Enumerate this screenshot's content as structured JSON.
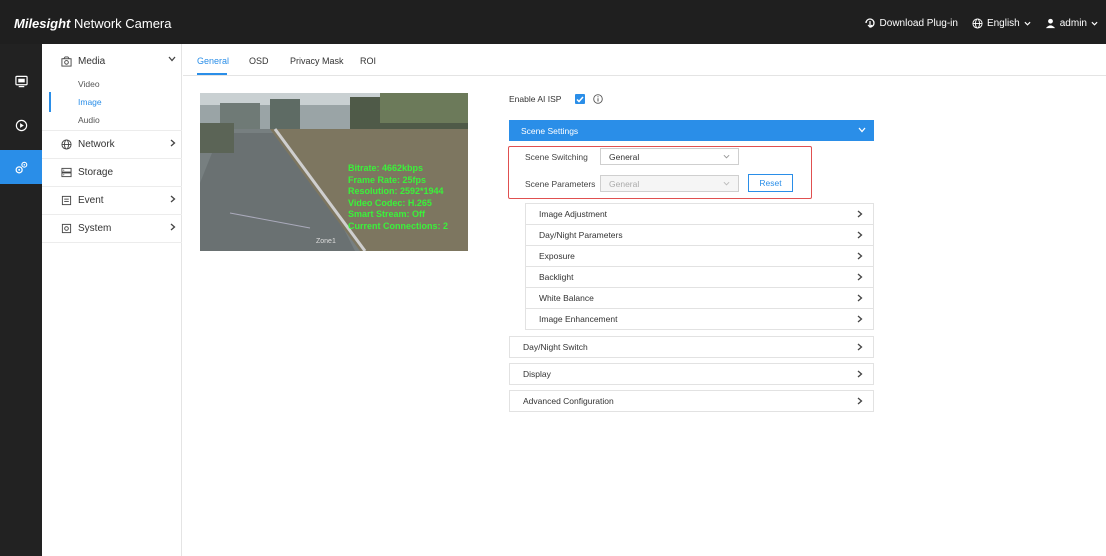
{
  "app": {
    "brand": "Milesight",
    "title": "Network Camera",
    "download_plugin": "Download Plug-in",
    "language": "English",
    "user": "admin"
  },
  "rail_icons": [
    "monitor-icon",
    "playback-icon",
    "settings-icon"
  ],
  "sidebar": {
    "media_label": "Media",
    "media_items": [
      "Video",
      "Image",
      "Audio"
    ],
    "network_label": "Network",
    "storage_label": "Storage",
    "event_label": "Event",
    "system_label": "System"
  },
  "tabs": [
    "General",
    "OSD",
    "Privacy Mask",
    "ROI"
  ],
  "preview": {
    "overlay_lines": [
      "Bitrate: 4662kbps",
      "Frame Rate: 25fps",
      "Resolution: 2592*1944",
      "Video Codec: H.265",
      "Smart Stream: Off",
      "Current Connections: 2"
    ],
    "tag": "Zone1"
  },
  "settings": {
    "enable_ai_isp_label": "Enable AI ISP",
    "scene_settings_label": "Scene Settings",
    "scene_switching_label": "Scene Switching",
    "scene_switching_value": "General",
    "scene_parameters_label": "Scene Parameters",
    "scene_parameters_value": "General",
    "reset_label": "Reset",
    "sub_sections": [
      "Image Adjustment",
      "Day/Night Parameters",
      "Exposure",
      "Backlight",
      "White Balance",
      "Image Enhancement"
    ],
    "sections": [
      "Day/Night Switch",
      "Display",
      "Advanced Configuration"
    ]
  },
  "colors": {
    "accent": "#2a8ee8",
    "topbar": "#1f1f1f",
    "highlight_box": "#e05050",
    "overlay_text": "#3af23a"
  }
}
